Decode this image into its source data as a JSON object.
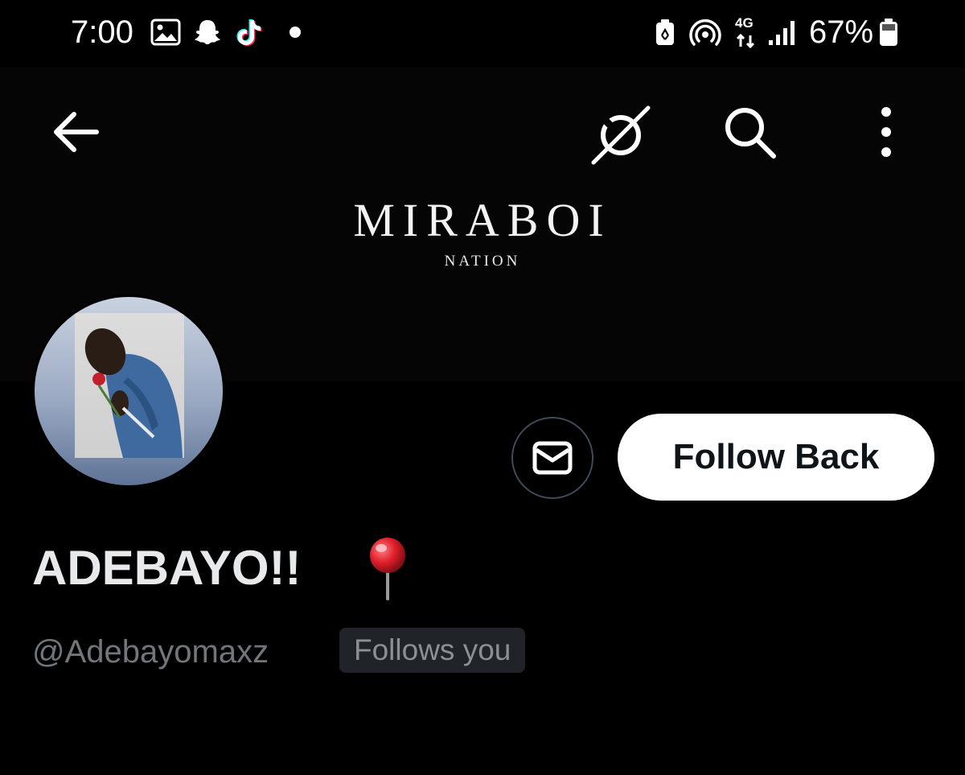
{
  "status_bar": {
    "time": "7:00",
    "network_type": "4G",
    "battery_percent": "67%",
    "icons": [
      "gallery-icon",
      "snapchat-icon",
      "tiktok-icon",
      "notification-dot-icon",
      "battery-saver-icon",
      "hotspot-icon",
      "network-4g-icon",
      "signal-icon",
      "battery-icon"
    ]
  },
  "banner": {
    "title": "MIRABOI",
    "subtitle": "NATION"
  },
  "nav": {
    "icons": [
      "back-arrow-icon",
      "grok-icon",
      "search-icon",
      "more-vertical-icon"
    ]
  },
  "profile": {
    "display_name": "ADEBAYO!!",
    "display_name_emoji": "pushpin-icon",
    "handle": "@Adebayomaxz",
    "follows_you_label": "Follows you"
  },
  "actions": {
    "message_icon": "envelope-icon",
    "follow_label": "Follow Back"
  },
  "colors": {
    "background": "#000000",
    "follow_button_bg": "#ffffff",
    "follow_button_text": "#0f1419",
    "secondary_text": "#71767b",
    "badge_bg": "#202327",
    "pin_red": "#e0202b"
  }
}
